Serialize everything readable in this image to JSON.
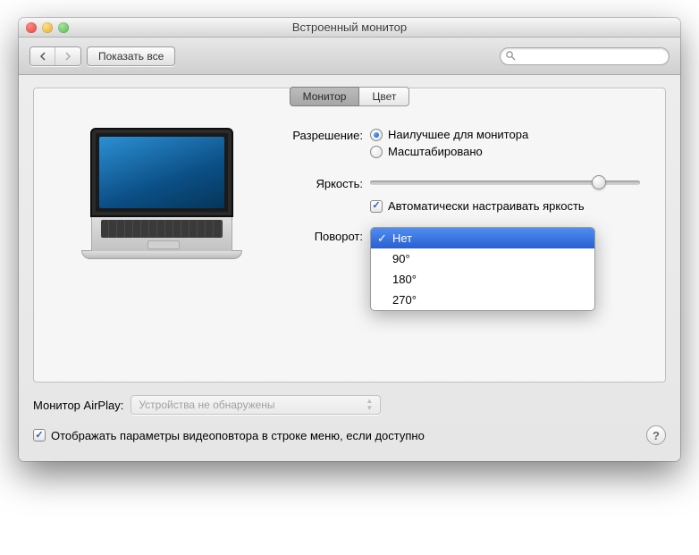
{
  "window": {
    "title": "Встроенный монитор"
  },
  "toolbar": {
    "show_all": "Показать все",
    "search_placeholder": ""
  },
  "tabs": {
    "monitor": "Монитор",
    "color": "Цвет"
  },
  "settings": {
    "resolution_label": "Разрешение:",
    "resolution_options": {
      "best": "Наилучшее для монитора",
      "scaled": "Масштабировано"
    },
    "brightness_label": "Яркость:",
    "brightness_value": 82,
    "auto_brightness": "Автоматически настраивать яркость",
    "rotation_label": "Поворот:",
    "rotation_options": [
      "Нет",
      "90°",
      "180°",
      "270°"
    ],
    "rotation_selected": "Нет"
  },
  "airplay": {
    "label": "Монитор AirPlay:",
    "value": "Устройства не обнаружены"
  },
  "mirroring_checkbox": "Отображать параметры видеоповтора в строке меню, если доступно",
  "help": "?"
}
